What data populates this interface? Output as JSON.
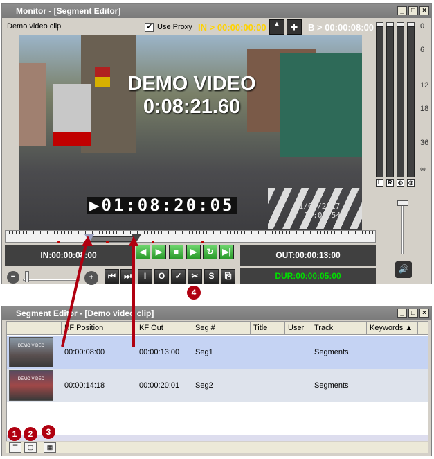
{
  "monitor": {
    "title": "Monitor - [Segment Editor]",
    "clip_name": "Demo video clip",
    "use_proxy_label": "Use Proxy",
    "use_proxy_checked": "✔",
    "in_readout": "IN > 00:00:00:00",
    "b_readout": "B > 00:00:08:00",
    "video_overlay_line1": "DEMO VIDEO",
    "video_overlay_line2": "0:08:21.60",
    "timecode_overlay": "▶01:08:20:05",
    "date_overlay_line1": "11/07/2017",
    "date_overlay_line2": "10:02:54",
    "in_point": "IN:00:00:08:00",
    "out_point": "OUT:00:00:13:00",
    "duration": "DUR:00:00:05:00",
    "db_scale": [
      "0",
      "6",
      "12",
      "18",
      "36",
      "∞"
    ],
    "vu_labels": [
      "L",
      "R",
      "◎",
      "◎"
    ],
    "transport_icons": [
      "step-back-icon",
      "step-forward-icon",
      "stop-icon",
      "play-icon",
      "loop-icon",
      "play-range-icon"
    ],
    "tool_icons": [
      "go-start-icon",
      "go-end-icon",
      "mark-in-icon",
      "mark-out-icon",
      "check-icon",
      "scissors-icon",
      "segment-icon",
      "export-icon"
    ],
    "tool_glyphs": [
      "⏮",
      "⏭",
      "I",
      "O",
      "✓",
      "✂",
      "S",
      "⎘"
    ]
  },
  "segment_editor": {
    "title": "Segment Editor - [Demo video clip]",
    "columns": [
      "",
      "KF Position",
      "KF Out Position",
      "Seg #",
      "Title",
      "User",
      "Track",
      "Keywords"
    ],
    "rows": [
      {
        "kf_position": "00:00:08:00",
        "kf_out_position": "00:00:13:00",
        "seg": "Seg1",
        "title": "",
        "user": "",
        "track": "Segments",
        "keywords": "",
        "thumb_text": "DEMO VIDEO"
      },
      {
        "kf_position": "00:00:14:18",
        "kf_out_position": "00:00:20:01",
        "seg": "Seg2",
        "title": "",
        "user": "",
        "track": "Segments",
        "keywords": "",
        "thumb_text": "DEMO VIDEO"
      }
    ]
  },
  "badges": [
    "1",
    "2",
    "3",
    "4"
  ],
  "colors": {
    "in_readout": "#ffd200",
    "duration": "#00e000",
    "badge": "#b00010",
    "row_selected": "#c5d3f3"
  }
}
